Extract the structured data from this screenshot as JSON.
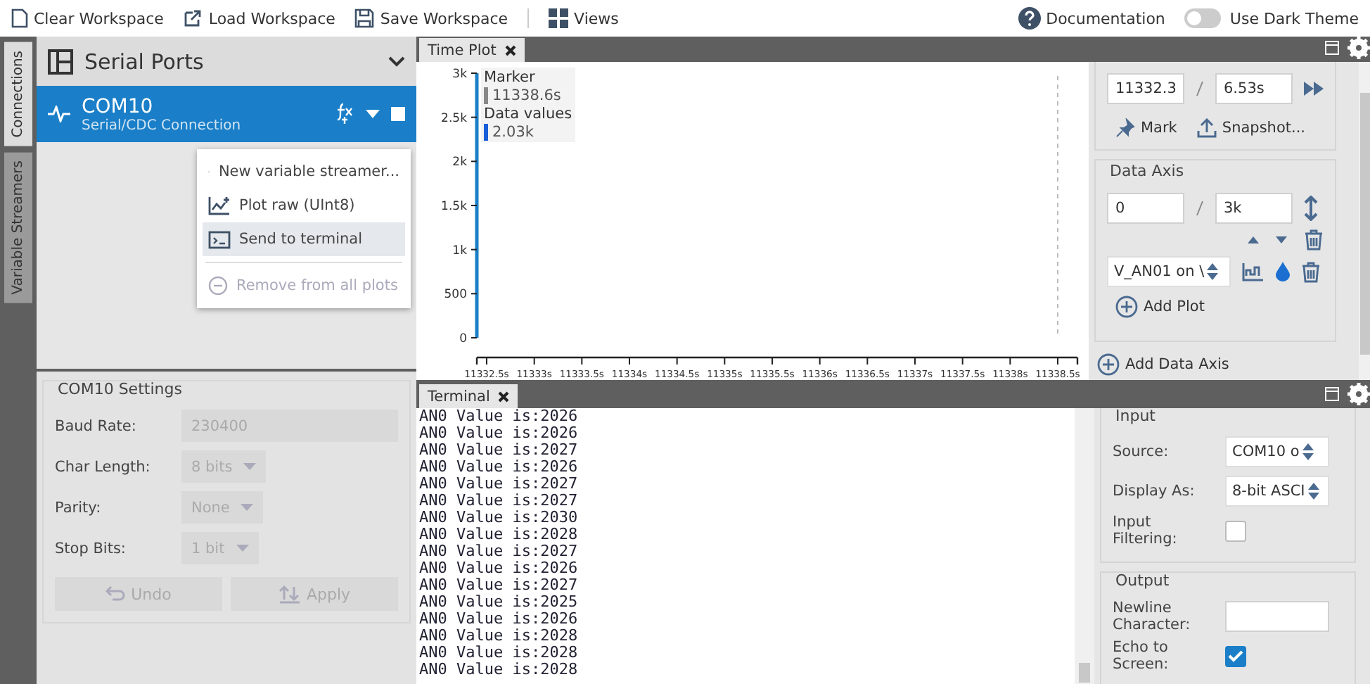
{
  "toolbar": {
    "items": [
      {
        "label": "Clear Workspace"
      },
      {
        "label": "Load Workspace"
      },
      {
        "label": "Save Workspace"
      },
      {
        "label": "Views"
      }
    ],
    "documentation": "Documentation",
    "dark_theme": {
      "label": "Use Dark Theme",
      "on": false
    }
  },
  "side_tabs": [
    {
      "label": "Connections",
      "selected": true
    },
    {
      "label": "Variable Streamers",
      "selected": false
    }
  ],
  "connections": {
    "title": "Serial Ports",
    "connection": {
      "name": "COM10",
      "subtitle": "Serial/CDC Connection"
    },
    "context_menu": [
      {
        "label": "New variable streamer...",
        "selected": false,
        "disabled": false
      },
      {
        "label": "Plot raw (UInt8)",
        "selected": false,
        "disabled": false
      },
      {
        "label": "Send to terminal",
        "selected": true,
        "disabled": false
      },
      {
        "label": "Remove from all plots",
        "selected": false,
        "disabled": true
      }
    ]
  },
  "settings": {
    "title": "COM10 Settings",
    "fields": [
      {
        "label": "Baud Rate:",
        "value": "230400",
        "kind": "text"
      },
      {
        "label": "Char Length:",
        "value": "8 bits",
        "kind": "select"
      },
      {
        "label": "Parity:",
        "value": "None",
        "kind": "select"
      },
      {
        "label": "Stop Bits:",
        "value": "1 bit",
        "kind": "select"
      }
    ],
    "buttons": [
      {
        "label": "Undo",
        "disabled": true
      },
      {
        "label": "Apply",
        "disabled": true
      }
    ]
  },
  "time_plot": {
    "tab": "Time Plot",
    "legend": {
      "marker_title": "Marker",
      "marker_value": "11338.6s",
      "values_title": "Data values",
      "values_value": "2.03k"
    },
    "chart_data": {
      "type": "line",
      "categories": [
        "11332.5s",
        "11333s",
        "11333.5s",
        "11334s",
        "11334.5s",
        "11335s",
        "11335.5s",
        "11336s",
        "11336.5s",
        "11337s",
        "11337.5s",
        "11338s",
        "11338.5s"
      ],
      "ylim": [
        0,
        3000
      ],
      "yticks": [
        {
          "value": 0,
          "label": "0"
        },
        {
          "value": 500,
          "label": "500"
        },
        {
          "value": 1000,
          "label": "1k"
        },
        {
          "value": 1500,
          "label": "1.5k"
        },
        {
          "value": 2000,
          "label": "2k"
        },
        {
          "value": 2500,
          "label": "2.5k"
        },
        {
          "value": 3000,
          "label": "3k"
        }
      ]
    }
  },
  "plot_controls": {
    "start": "11332.3",
    "span": "6.53s",
    "mark": "Mark",
    "snapshot": "Snapshot...",
    "data_axis": {
      "title": "Data Axis",
      "min": "0",
      "max": "3k",
      "source": "V_AN01 on \\",
      "add_plot": "Add Plot"
    },
    "add_data_axis": "Add Data Axis"
  },
  "terminal": {
    "tab": "Terminal",
    "lines": [
      "AN0 Value is:2026",
      "AN0 Value is:2026",
      "AN0 Value is:2027",
      "AN0 Value is:2026",
      "AN0 Value is:2027",
      "AN0 Value is:2027",
      "AN0 Value is:2030",
      "AN0 Value is:2028",
      "AN0 Value is:2027",
      "AN0 Value is:2026",
      "AN0 Value is:2027",
      "AN0 Value is:2025",
      "AN0 Value is:2026",
      "AN0 Value is:2028",
      "AN0 Value is:2028",
      "AN0 Value is:2028"
    ],
    "input": {
      "title": "Input",
      "source_label": "Source:",
      "source": "COM10 o",
      "display_label": "Display As:",
      "display": "8-bit ASCI",
      "filtering_label": "Input Filtering:",
      "filtering": false
    },
    "output": {
      "title": "Output",
      "newline_label": "Newline Character:",
      "echo_label": "Echo to Screen:",
      "echo": true
    }
  }
}
